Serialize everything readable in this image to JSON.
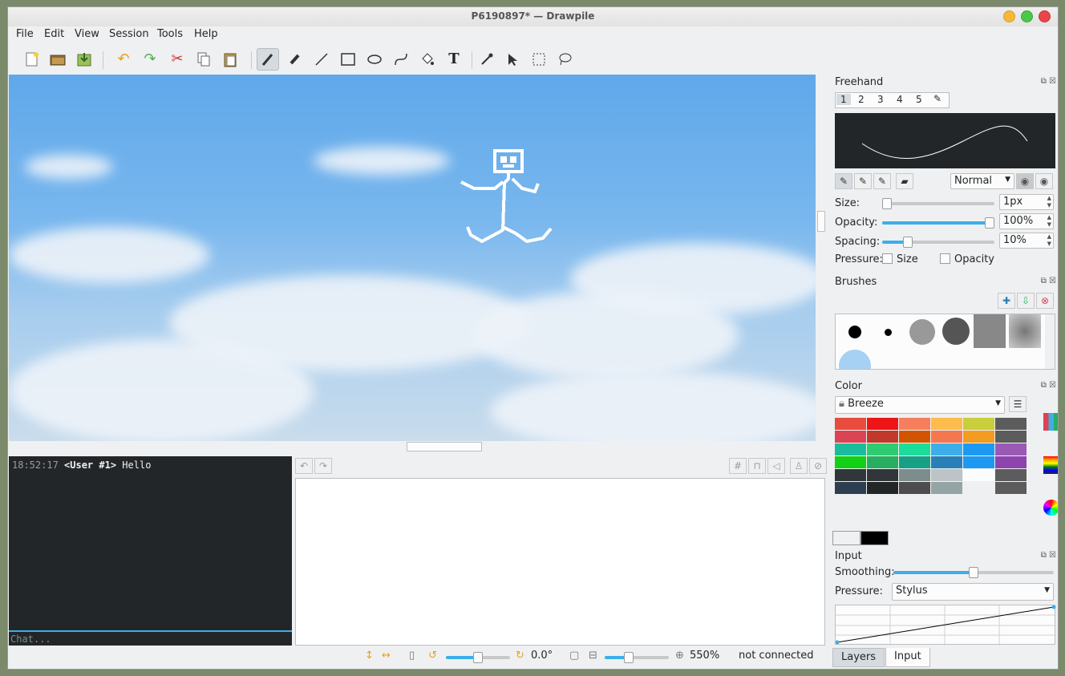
{
  "window": {
    "title": "P6190897* — Drawpile"
  },
  "menu": [
    "File",
    "Edit",
    "View",
    "Session",
    "Tools",
    "Help"
  ],
  "toolbar": {
    "icons": [
      "new-document-icon",
      "open-folder-icon",
      "save-icon",
      "undo-icon",
      "redo-icon",
      "cut-icon",
      "copy-icon",
      "paste-icon",
      "freehand-brush-icon",
      "eraser-icon",
      "line-icon",
      "rectangle-icon",
      "ellipse-icon",
      "bezier-icon",
      "fill-bucket-icon",
      "text-icon",
      "color-picker-icon",
      "select-pointer-icon",
      "rectangle-select-icon",
      "lasso-select-icon"
    ]
  },
  "chat": {
    "time": "18:52:17",
    "user": "<User #1>",
    "message": "Hello",
    "placeholder": "Chat..."
  },
  "status": {
    "rotation": "0.0°",
    "zoom": "550%",
    "connection": "not connected",
    "rotation_slider": 0.5,
    "zoom_slider": 0.35
  },
  "freehand": {
    "title": "Freehand",
    "tabs": [
      "1",
      "2",
      "3",
      "4",
      "5"
    ],
    "blend_mode": "Normal",
    "size_label": "Size:",
    "size_value": "1px",
    "size_level": 0.0,
    "opacity_label": "Opacity:",
    "opacity_value": "100%",
    "opacity_level": 1.0,
    "spacing_label": "Spacing:",
    "spacing_value": "10%",
    "spacing_level": 0.2,
    "pressure_label": "Pressure:",
    "pressure_size": "Size",
    "pressure_opacity": "Opacity"
  },
  "brushes": {
    "title": "Brushes"
  },
  "color": {
    "title": "Color",
    "palette": "Breeze",
    "swatches": [
      [
        "#e74c3c",
        "#ed1515",
        "#f67e5c",
        "#fdbc4b",
        "#c9ce3b",
        "#5c5c5c"
      ],
      [
        "#da4453",
        "#c0392b",
        "#d35400",
        "#f47750",
        "#f39c1f",
        "#5c5c5c"
      ],
      [
        "#1abc9c",
        "#2ecc71",
        "#1cdc9a",
        "#3daee9",
        "#1d99f3",
        "#9b59b6"
      ],
      [
        "#11d116",
        "#27ae60",
        "#16a085",
        "#2980b9",
        "#1d99f3",
        "#8e44ad"
      ],
      [
        "#31363b",
        "#31363b",
        "#7f8c8d",
        "#bdc3c7",
        "#fcfcfc",
        "#5c5c5c"
      ],
      [
        "#2c3e50",
        "#232627",
        "#4d4d4d",
        "#95a5a6",
        "#eff0f1",
        "#5c5c5c"
      ]
    ],
    "background_color": "#eff0f1",
    "foreground_color": "#000000"
  },
  "input": {
    "title": "Input",
    "smoothing_label": "Smoothing:",
    "smoothing_level": 0.5,
    "pressure_label": "Pressure:",
    "pressure_value": "Stylus"
  },
  "tabs": [
    "Layers",
    "Input"
  ],
  "colors": {
    "accent": "#3daee9",
    "selection_bg": "#d6dbe0"
  }
}
